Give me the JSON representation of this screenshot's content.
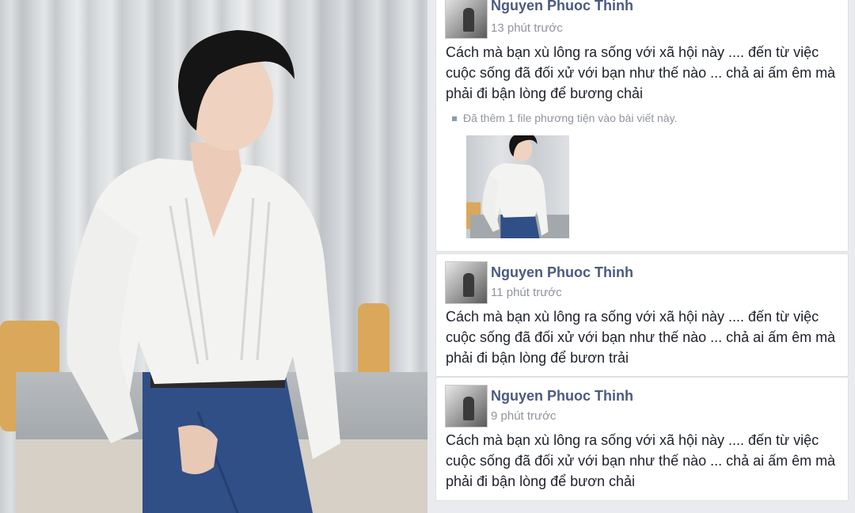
{
  "posts": [
    {
      "author": "Nguyen Phuoc Thinh",
      "time": "13 phút trước",
      "text": "Cách mà bạn xù lông ra sống với xã hội này .... đến từ việc cuộc sống đã đối xử với bạn như thế nào ... chả ai ấm êm mà phải đi bận lòng để bương chải",
      "note": "Đã thêm 1 file phương tiện vào bài viết này."
    },
    {
      "author": "Nguyen Phuoc Thinh",
      "time": "11 phút trước",
      "text": "Cách mà bạn xù lông ra sống với xã hội này .... đến từ việc cuộc sống đã đối xử với bạn như thế nào ... chả ai ấm êm mà phải đi bận lòng để bươn trải"
    },
    {
      "author": "Nguyen Phuoc Thinh",
      "time": "9 phút trước",
      "text": "Cách mà bạn xù lông ra sống với xã hội này .... đến từ việc cuộc sống đã đối xử với bạn như thế nào ... chả ai ấm êm mà phải đi bận lòng để bươn chải"
    }
  ],
  "colors": {
    "name": "#4b5b7f",
    "meta": "#90949c",
    "text": "#1d2129",
    "background": "#e9ebee"
  }
}
